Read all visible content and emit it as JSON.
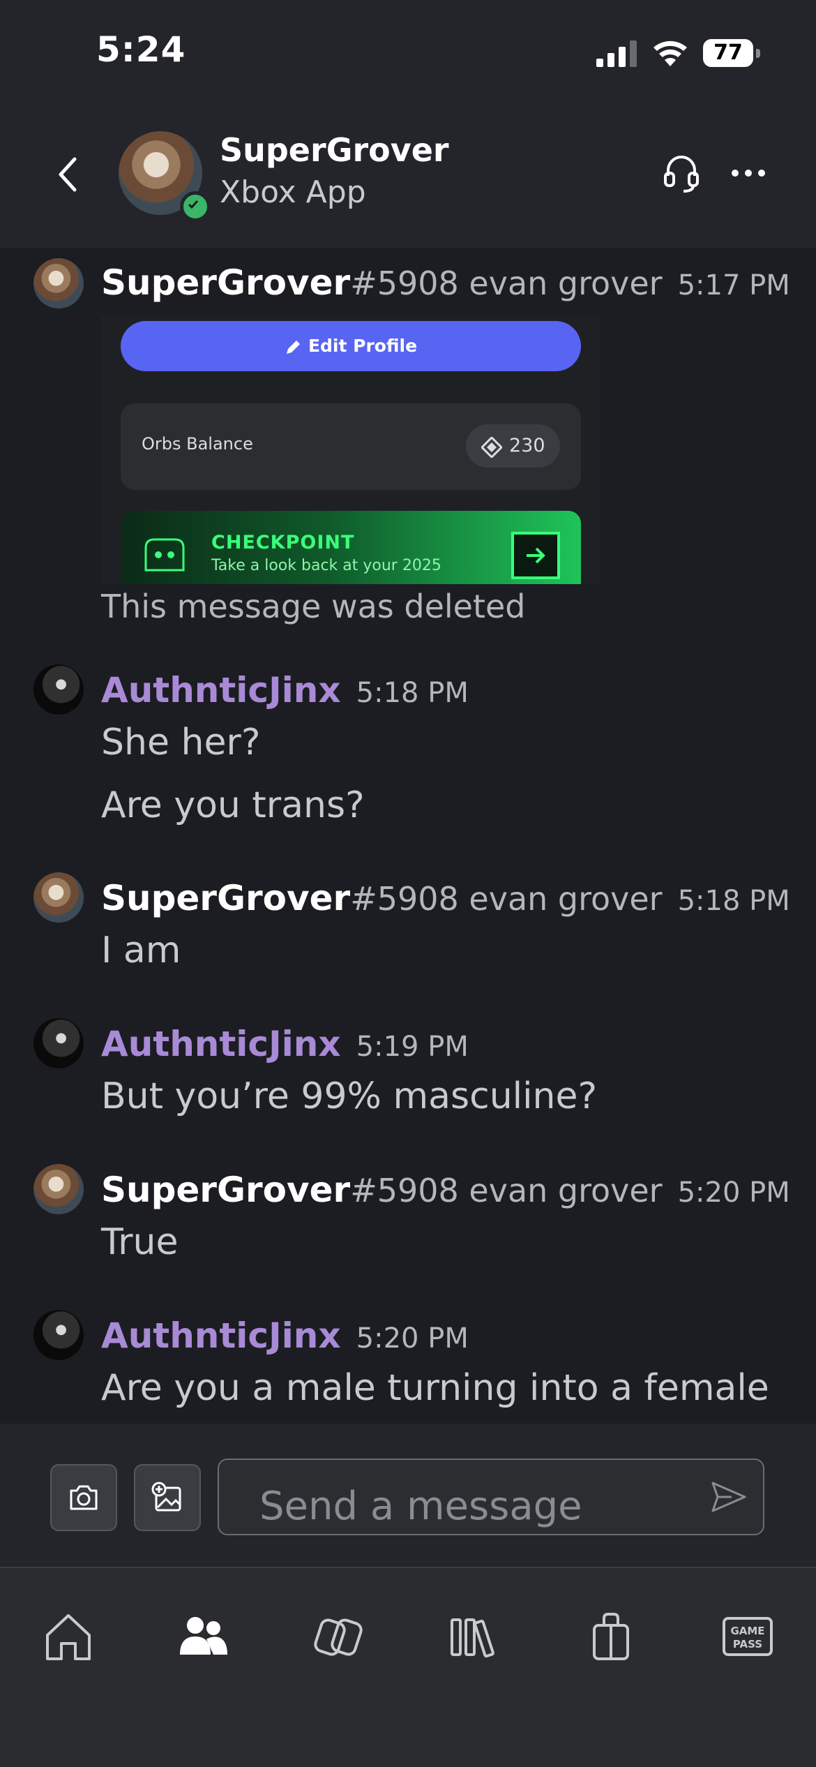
{
  "status": {
    "time": "5:24",
    "battery": "77"
  },
  "header": {
    "name": "SuperGrover",
    "subtitle": "Xbox App"
  },
  "messages": [
    {
      "user": "SuperGrover",
      "tag": "#5908 evan grover",
      "time": "5:17 PM",
      "text": ""
    },
    {
      "user": "AuthnticJinx",
      "tag": "",
      "time": "5:18 PM",
      "text": "She her?",
      "text2": "Are you trans?"
    },
    {
      "user": "SuperGrover",
      "tag": "#5908 evan grover",
      "time": "5:18 PM",
      "text": "I am"
    },
    {
      "user": "AuthnticJinx",
      "tag": "",
      "time": "5:19 PM",
      "text": "But you’re 99% masculine?"
    },
    {
      "user": "SuperGrover",
      "tag": "#5908 evan grover",
      "time": "5:20 PM",
      "text": "True"
    },
    {
      "user": "AuthnticJinx",
      "tag": "",
      "time": "5:20 PM",
      "text": "Are you a male turning into a female"
    }
  ],
  "embed": {
    "edit_profile": "Edit Profile",
    "orbs_label": "Orbs Balance",
    "orbs_value": "230",
    "checkpoint_title": "CHECKPOINT",
    "checkpoint_sub": "Take a look back at your 2025"
  },
  "deleted_text": "This message was deleted",
  "composer": {
    "placeholder": "Send a message"
  },
  "nav": {
    "gamepass": "GAME PASS",
    "gamepass_l1": "GAME",
    "gamepass_l2": "PASS"
  },
  "colors": {
    "accent": "#5865f2",
    "purple_name": "#a98ad6",
    "online": "#3bb567"
  }
}
